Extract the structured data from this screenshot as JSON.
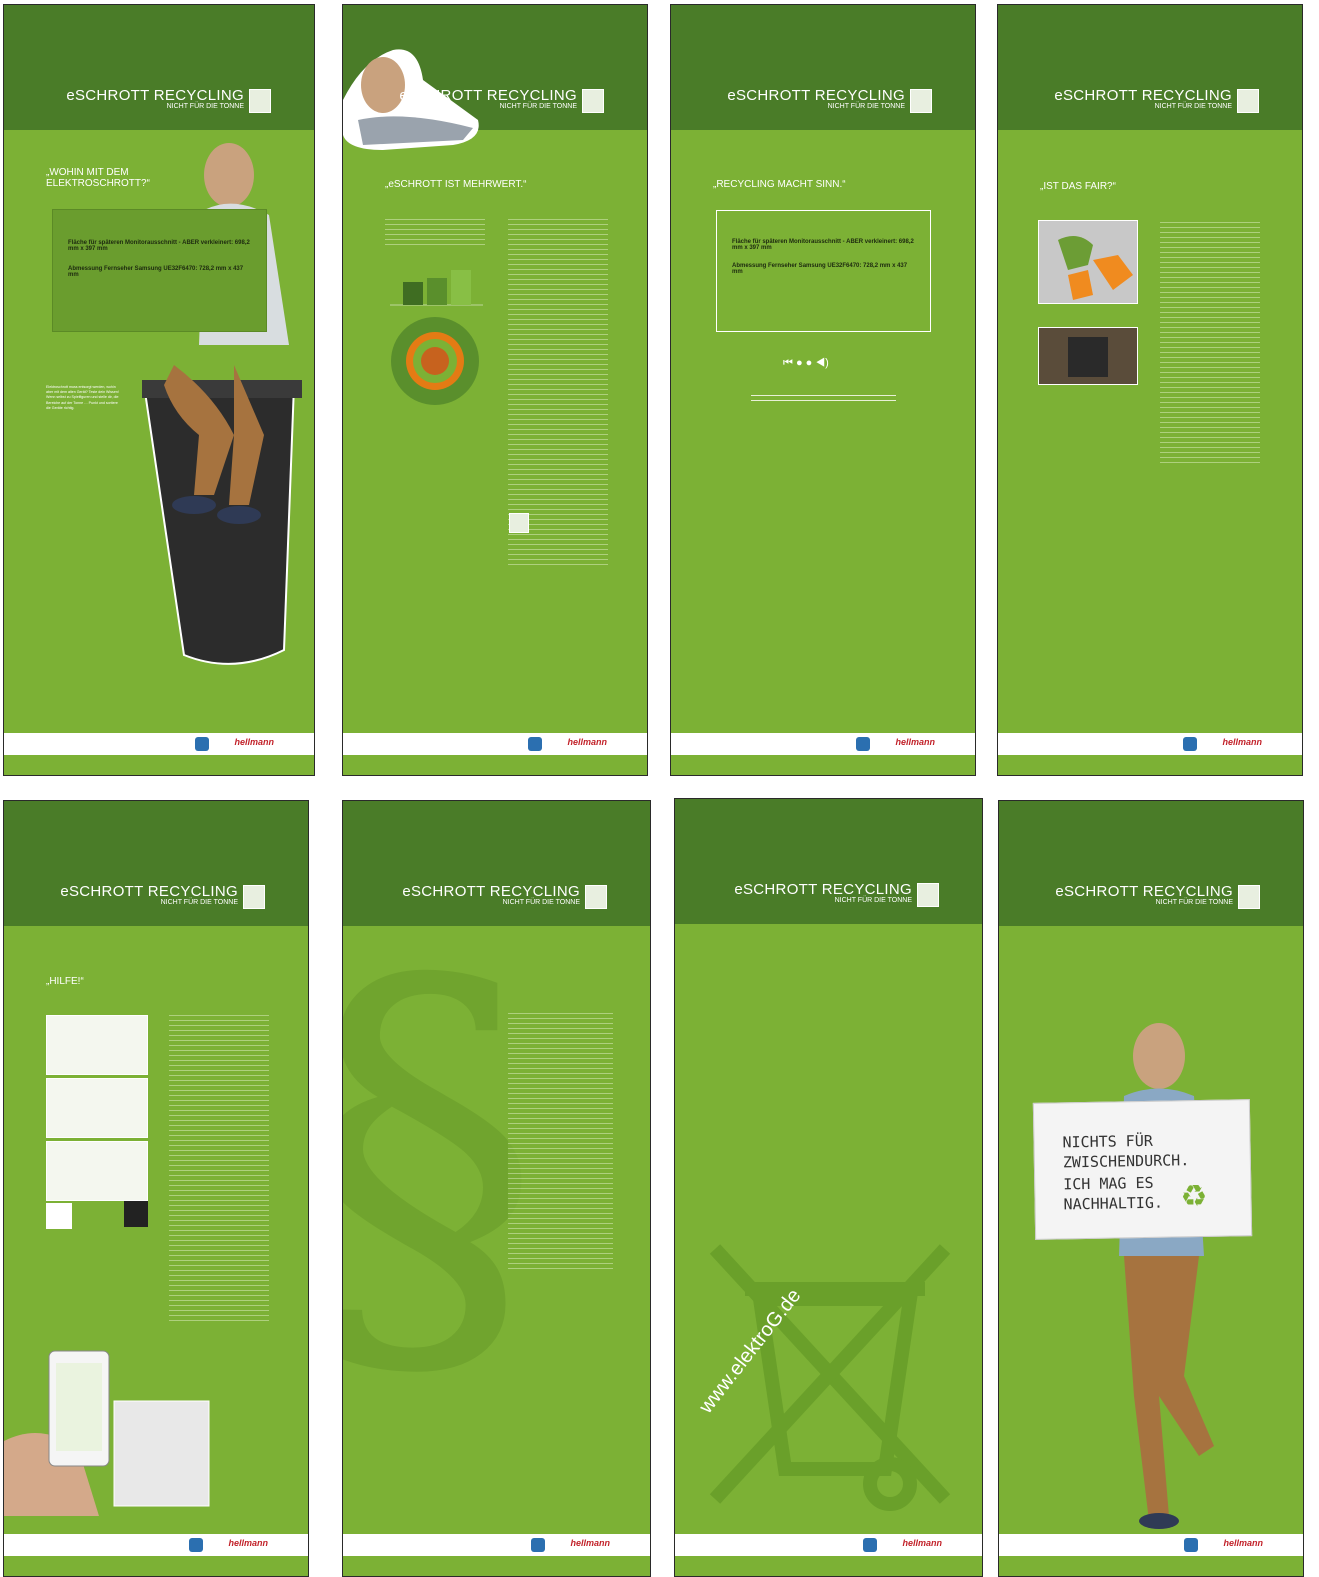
{
  "brand": {
    "title": "eSCHROTT RECYCLING",
    "subtitle": "NICHT FÜR DIE TONNE"
  },
  "footer_logo": "hellmann",
  "panel1": {
    "quote": "„WOHIN MIT DEM ELEKTROSCHROTT?“",
    "box_line1": "Fläche für späteren Monitorausschnitt - ABER verkleinert: 698,2 mm x 397 mm",
    "box_line2": "Abmessung Fernseher Samsung UE32F6470: 728,2 mm x 437 mm",
    "text": "Elektroschrott muss entsorgt werden, wohin aber mit dem alten Gerät? Teste dein Wissen! Wenn selbst zu Spielfiguren und stelle dir, die Bereiche auf der Tonne … Punkt und sortiere die Geräte richtig."
  },
  "panel2": {
    "quote": "„eSCHROTT IST MEHRWERT.“"
  },
  "panel3": {
    "quote": "„RECYCLING MACHT SINN.“",
    "box_line1": "Fläche für späteren Monitorausschnitt - ABER verkleinert: 698,2 mm x 397 mm",
    "box_line2": "Abmessung Fernseher Samsung UE32F6470: 728,2 mm x 437 mm",
    "controls": "⏮ ●   ● ◀)"
  },
  "panel4": {
    "quote": "„IST DAS FAIR?“"
  },
  "panel5": {
    "quote": "„HILFE!“"
  },
  "panel7": {
    "url": "www.elektroG.de"
  },
  "panel8": {
    "sign_line1": "NICHTS FÜR",
    "sign_line2": "ZWISCHENDURCH.",
    "sign_line3": "ICH MAG ES",
    "sign_line4": "NACHHALTIG."
  },
  "colors": {
    "panel_green": "#7cb135",
    "header_green": "#4a7c28"
  }
}
